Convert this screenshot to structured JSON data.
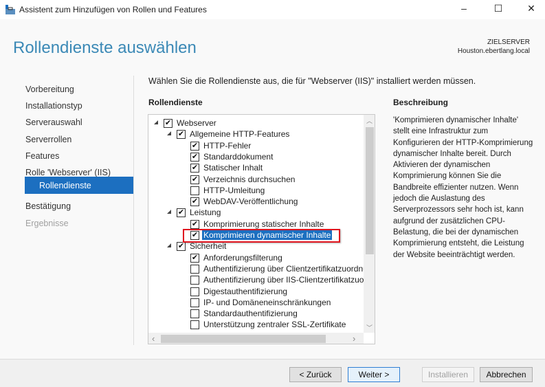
{
  "window": {
    "title": "Assistent zum Hinzufügen von Rollen und Features",
    "minimize": "–",
    "maximize": "☐",
    "close": "✕"
  },
  "header": {
    "title": "Rollendienste auswählen",
    "server_label": "ZIELSERVER",
    "server_name": "Houston.ebertlang.local"
  },
  "sidebar": {
    "items": [
      {
        "label": "Vorbereitung",
        "state": "normal"
      },
      {
        "label": "Installationstyp",
        "state": "normal"
      },
      {
        "label": "Serverauswahl",
        "state": "normal"
      },
      {
        "label": "Serverrollen",
        "state": "normal"
      },
      {
        "label": "Features",
        "state": "normal"
      },
      {
        "label": "Rolle 'Webserver' (IIS)",
        "state": "normal"
      },
      {
        "label": "Rollendienste",
        "state": "selected"
      },
      {
        "label": "Bestätigung",
        "state": "normal"
      },
      {
        "label": "Ergebnisse",
        "state": "disabled"
      }
    ]
  },
  "content": {
    "intro": "Wählen Sie die Rollendienste aus, die für \"Webserver (IIS)\" installiert werden müssen.",
    "roles_heading": "Rollendienste",
    "desc_heading": "Beschreibung",
    "description": "'Komprimieren dynamischer Inhalte' stellt eine Infrastruktur zum Konfigurieren der HTTP-Komprimierung dynamischer Inhalte bereit. Durch Aktivieren der dynamischen Komprimierung können Sie die Bandbreite effizienter nutzen. Wenn jedoch die Auslastung des Serverprozessors sehr hoch ist, kann aufgrund der zusätzlichen CPU-Belastung, die bei der dynamischen Komprimierung entsteht, die Leistung der Website beeinträchtigt werden."
  },
  "tree": [
    {
      "label": "Webserver",
      "level": 0,
      "expandable": true,
      "checked": true
    },
    {
      "label": "Allgemeine HTTP-Features",
      "level": 1,
      "expandable": true,
      "checked": true
    },
    {
      "label": "HTTP-Fehler",
      "level": 2,
      "checked": true
    },
    {
      "label": "Standarddokument",
      "level": 2,
      "checked": true
    },
    {
      "label": "Statischer Inhalt",
      "level": 2,
      "checked": true
    },
    {
      "label": "Verzeichnis durchsuchen",
      "level": 2,
      "checked": true
    },
    {
      "label": "HTTP-Umleitung",
      "level": 2,
      "checked": false
    },
    {
      "label": "WebDAV-Veröffentlichung",
      "level": 2,
      "checked": true
    },
    {
      "label": "Leistung",
      "level": 1,
      "expandable": true,
      "checked": true
    },
    {
      "label": "Komprimierung statischer Inhalte",
      "level": 2,
      "checked": true
    },
    {
      "label": "Komprimieren dynamischer Inhalte",
      "level": 2,
      "checked": true,
      "selected": true
    },
    {
      "label": "Sicherheit",
      "level": 1,
      "expandable": true,
      "checked": true
    },
    {
      "label": "Anforderungsfilterung",
      "level": 2,
      "checked": true
    },
    {
      "label": "Authentifizierung über Clientzertifikatzuordnung",
      "level": 2,
      "checked": false
    },
    {
      "label": "Authentifizierung über IIS-Clientzertifikatzuordnung",
      "level": 2,
      "checked": false
    },
    {
      "label": "Digestauthentifizierung",
      "level": 2,
      "checked": false
    },
    {
      "label": "IP- und Domäneneinschränkungen",
      "level": 2,
      "checked": false
    },
    {
      "label": "Standardauthentifizierung",
      "level": 2,
      "checked": false
    },
    {
      "label": "Unterstützung zentraler SSL-Zertifikate",
      "level": 2,
      "checked": false
    }
  ],
  "scroll": {
    "up": "︿",
    "down": "﹀",
    "left": "‹",
    "right": "›"
  },
  "footer": {
    "back": "< Zurück",
    "next": "Weiter >",
    "install": "Installieren",
    "cancel": "Abbrechen"
  },
  "colors": {
    "accent": "#1c6fc0",
    "title": "#3b89b6",
    "highlight_box": "#e0141e"
  }
}
